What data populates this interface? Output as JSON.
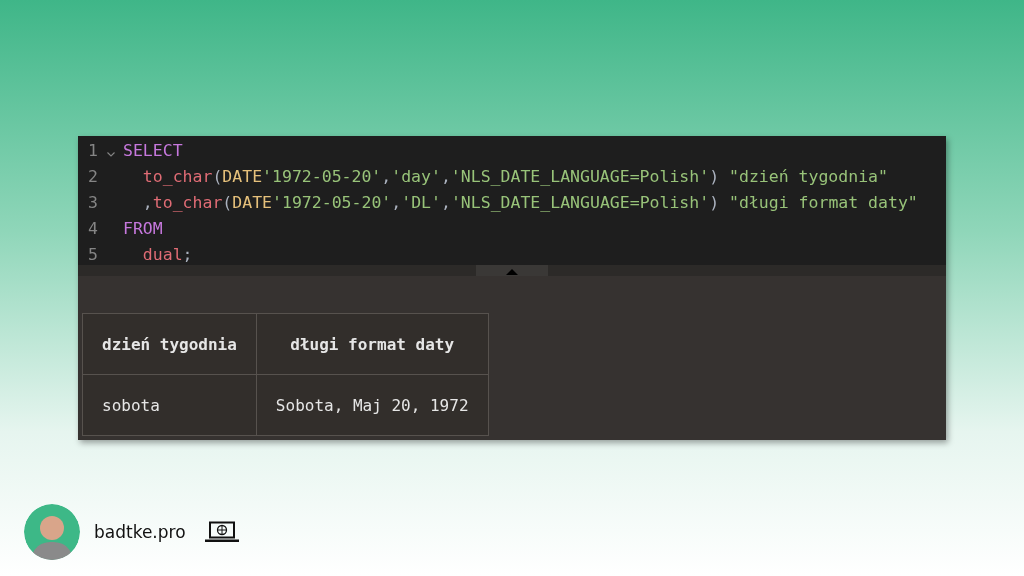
{
  "editor": {
    "lines": [
      {
        "number": "1",
        "foldable": true,
        "tokens": [
          {
            "kind": "keyword",
            "text": "SELECT"
          }
        ]
      },
      {
        "number": "2",
        "foldable": false,
        "tokens": [
          {
            "kind": "function",
            "text": "  to_char"
          },
          {
            "kind": "punct",
            "text": "("
          },
          {
            "kind": "type",
            "text": "DATE"
          },
          {
            "kind": "string",
            "text": "'1972-05-20'"
          },
          {
            "kind": "punct",
            "text": ","
          },
          {
            "kind": "string",
            "text": "'day'"
          },
          {
            "kind": "punct",
            "text": ","
          },
          {
            "kind": "string",
            "text": "'NLS_DATE_LANGUAGE=Polish'"
          },
          {
            "kind": "punct",
            "text": ") "
          },
          {
            "kind": "string",
            "text": "\"dzień tygodnia\""
          }
        ]
      },
      {
        "number": "3",
        "foldable": false,
        "tokens": [
          {
            "kind": "punct",
            "text": "  ,"
          },
          {
            "kind": "function",
            "text": "to_char"
          },
          {
            "kind": "punct",
            "text": "("
          },
          {
            "kind": "type",
            "text": "DATE"
          },
          {
            "kind": "string",
            "text": "'1972-05-20'"
          },
          {
            "kind": "punct",
            "text": ","
          },
          {
            "kind": "string",
            "text": "'DL'"
          },
          {
            "kind": "punct",
            "text": ","
          },
          {
            "kind": "string",
            "text": "'NLS_DATE_LANGUAGE=Polish'"
          },
          {
            "kind": "punct",
            "text": ") "
          },
          {
            "kind": "string",
            "text": "\"długi format daty\""
          }
        ]
      },
      {
        "number": "4",
        "foldable": false,
        "tokens": [
          {
            "kind": "keyword",
            "text": "FROM"
          }
        ]
      },
      {
        "number": "5",
        "foldable": false,
        "tokens": [
          {
            "kind": "function",
            "text": "  dual"
          },
          {
            "kind": "punct",
            "text": ";"
          }
        ]
      }
    ]
  },
  "results": {
    "columns": [
      "dzień tygodnia",
      "długi format daty"
    ],
    "rows": [
      [
        "sobota",
        "Sobota, Maj 20, 1972"
      ]
    ]
  },
  "footer": {
    "site": "badtke.pro"
  }
}
